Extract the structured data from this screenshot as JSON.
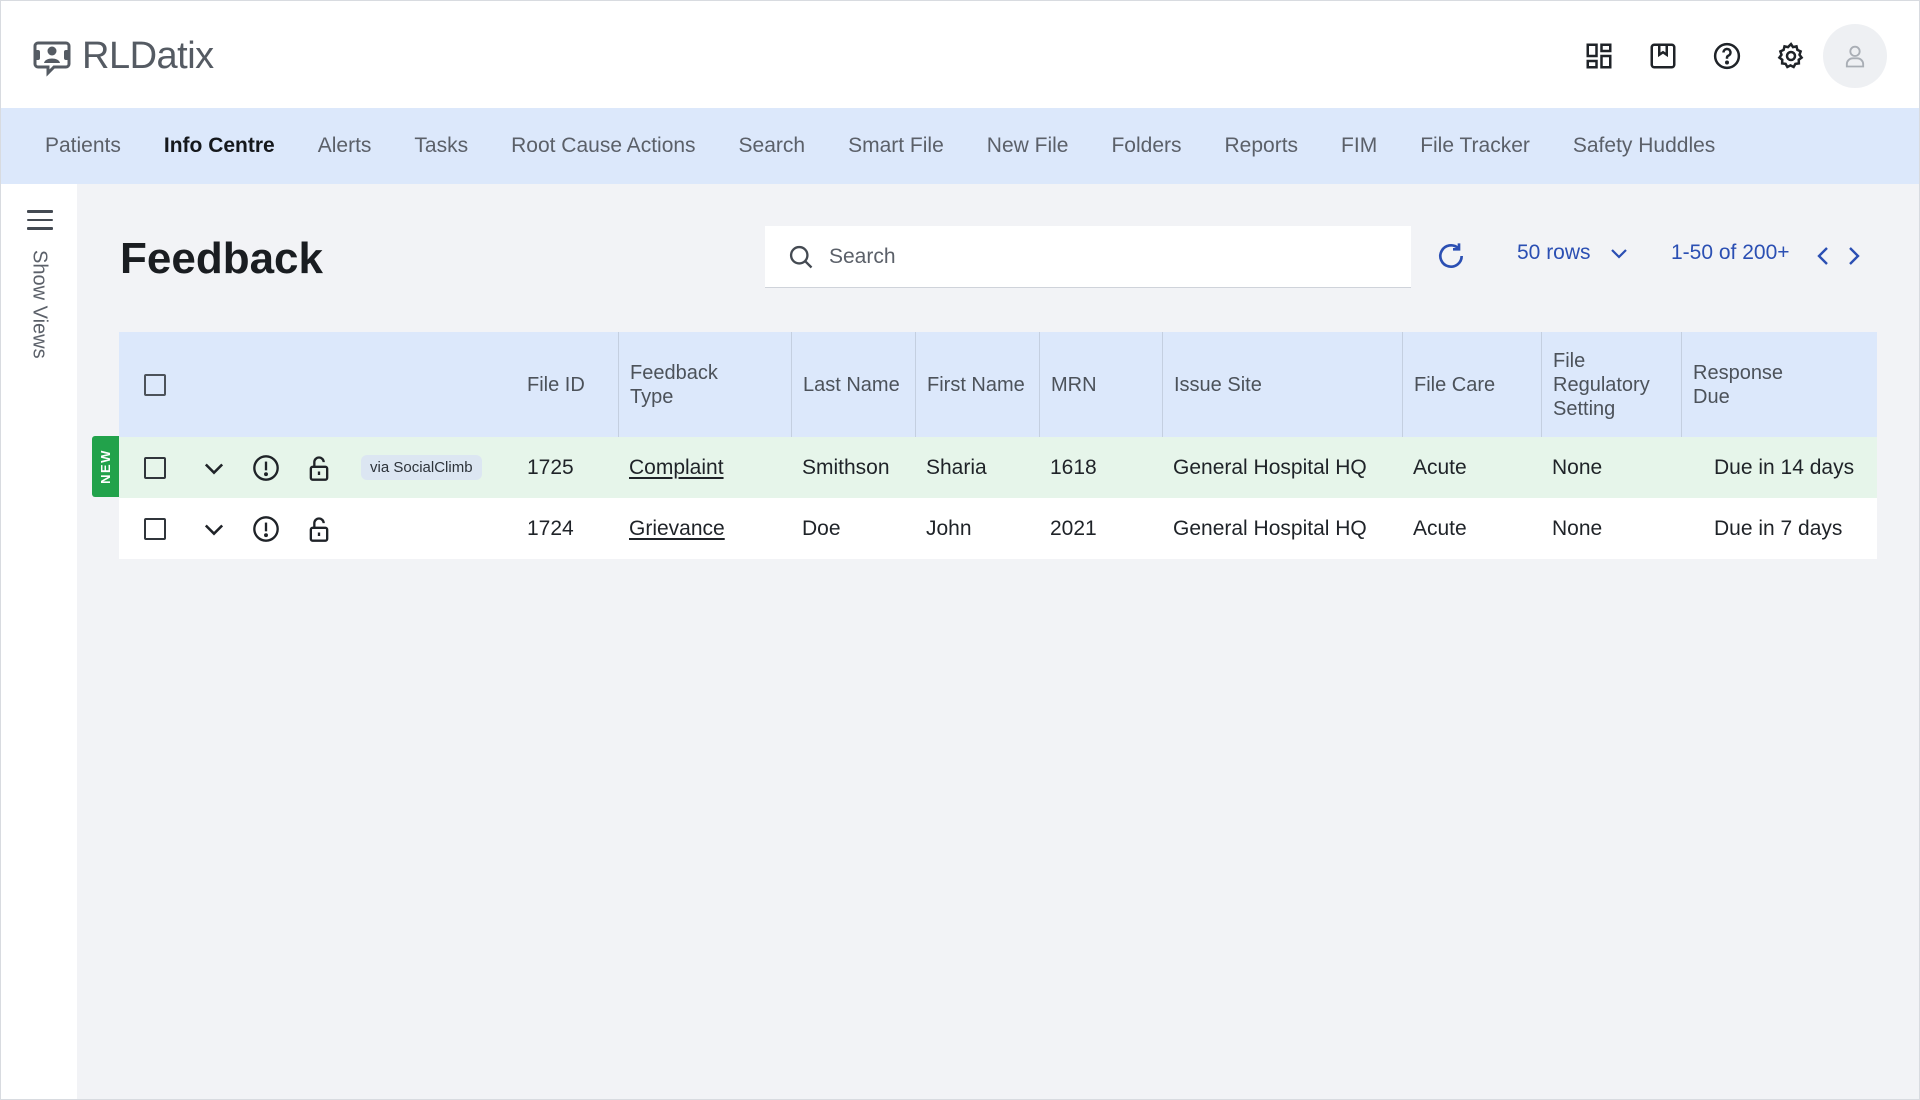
{
  "brand": {
    "name": "RLDatix"
  },
  "header": {
    "icons": [
      "dashboard-icon",
      "bookmark-icon",
      "help-icon",
      "settings-icon",
      "user-avatar-icon"
    ]
  },
  "nav": {
    "items": [
      {
        "label": "Patients",
        "active": false
      },
      {
        "label": "Info Centre",
        "active": true
      },
      {
        "label": "Alerts",
        "active": false
      },
      {
        "label": "Tasks",
        "active": false
      },
      {
        "label": "Root Cause Actions",
        "active": false
      },
      {
        "label": "Search",
        "active": false
      },
      {
        "label": "Smart File",
        "active": false
      },
      {
        "label": "New File",
        "active": false
      },
      {
        "label": "Folders",
        "active": false
      },
      {
        "label": "Reports",
        "active": false
      },
      {
        "label": "FIM",
        "active": false
      },
      {
        "label": "File Tracker",
        "active": false
      },
      {
        "label": "Safety Huddles",
        "active": false
      }
    ]
  },
  "sidebar": {
    "toggle_label": "Show Views"
  },
  "page": {
    "title": "Feedback",
    "search_placeholder": "Search",
    "rows_per_page": "50 rows",
    "paging": "1-50 of 200+"
  },
  "table": {
    "columns": {
      "file_id": "File ID",
      "feedback_type_1": "Feedback",
      "feedback_type_2": "Type",
      "last_name": "Last Name",
      "first_name": "First Name",
      "mrn": "MRN",
      "issue_site": "Issue Site",
      "file_care": "File Care",
      "reg_1": "File",
      "reg_2": "Regulatory",
      "reg_3": "Setting",
      "response_1": "Response",
      "response_2": "Due"
    },
    "rows": [
      {
        "is_new": true,
        "new_label": "NEW",
        "source": "via SocialClimb",
        "file_id": "1725",
        "feedback_type": "Complaint",
        "last_name": "Smithson",
        "first_name": "Sharia",
        "mrn": "1618",
        "issue_site": "General Hospital HQ",
        "file_care": "Acute",
        "regulatory_setting": "None",
        "response_due": "Due in 14 days"
      },
      {
        "is_new": false,
        "source": "",
        "file_id": "1724",
        "feedback_type": "Grievance",
        "last_name": "Doe",
        "first_name": "John",
        "mrn": "2021",
        "issue_site": "General Hospital HQ",
        "file_care": "Acute",
        "regulatory_setting": "None",
        "response_due": "Due in 7 days"
      }
    ]
  },
  "colors": {
    "nav_bg": "#dce8fb",
    "new_row_bg": "#e6f5ea",
    "new_badge": "#22a24b",
    "link_blue": "#2b4fb3"
  }
}
